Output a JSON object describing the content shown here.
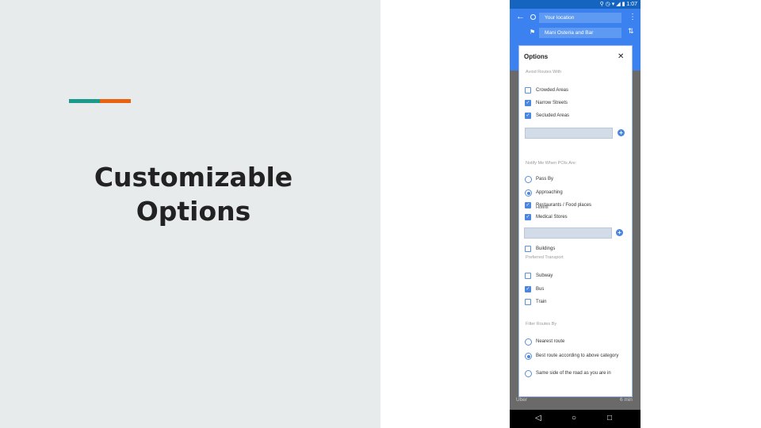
{
  "slide": {
    "title_line1": "Customizable",
    "title_line2": "Options",
    "accent_colors": [
      "#1a9a8a",
      "#e8620f"
    ]
  },
  "phone": {
    "status_time": "1:07",
    "header": {
      "origin_field": "Your location",
      "destination_field": "Mani Osteria and Bar"
    },
    "background": {
      "uber_label": "Uber",
      "uber_time": "6 min"
    },
    "dialog": {
      "title": "Options",
      "sections": {
        "avoid": {
          "heading": "Avoid Routes With",
          "items": [
            {
              "label": "Crowded Areas",
              "checked": false
            },
            {
              "label": "Narrow Streets",
              "checked": true
            },
            {
              "label": "Secluded Areas",
              "checked": true
            }
          ]
        },
        "notify": {
          "heading": "Notify Me When POIs Are:",
          "radios": [
            {
              "label": "Pass By",
              "selected": false
            },
            {
              "label": "Approaching",
              "selected": true
            }
          ],
          "items": [
            {
              "label": "Restaurants / Food places",
              "checked": true
            },
            {
              "label": "Medical Stores",
              "checked": true
            },
            {
              "label": "Buildings",
              "checked": false
            }
          ],
          "overlap_label": "Hotels"
        },
        "transport": {
          "heading": "Preferred Transport",
          "items": [
            {
              "label": "Subway",
              "checked": false
            },
            {
              "label": "Bus",
              "checked": true
            },
            {
              "label": "Train",
              "checked": false
            }
          ]
        },
        "filter": {
          "heading": "Filter Routes By",
          "radios": [
            {
              "label": "Nearest route",
              "selected": false
            },
            {
              "label": "Best route according to above category",
              "selected": true
            },
            {
              "label": "Same side of the road as you are in",
              "selected": false
            }
          ]
        }
      }
    }
  }
}
